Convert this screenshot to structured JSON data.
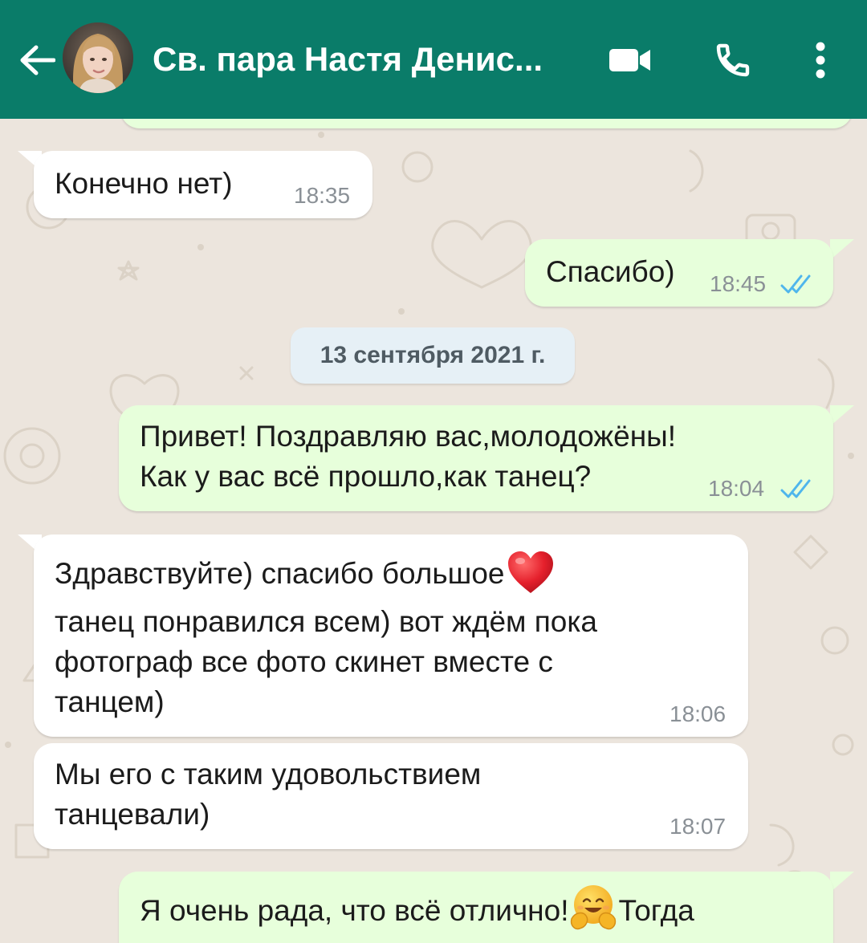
{
  "header": {
    "title": "Св. пара Настя Денис..."
  },
  "date_separator": "13 сентября 2021 г.",
  "messages": [
    {
      "direction": "in",
      "text": "Конечно нет)",
      "time": "18:35"
    },
    {
      "direction": "out",
      "text": "Спасибо)",
      "time": "18:45",
      "status": "read"
    },
    {
      "direction": "out",
      "line1": "Привет! Поздравляю вас,молодожёны!",
      "line2": "Как у вас всё прошло,как танец?",
      "time": "18:04",
      "status": "read"
    },
    {
      "direction": "in",
      "line1": "Здравствуйте) спасибо большое",
      "line2": "танец понравился всем) вот ждём пока",
      "line3": "фотограф все фото скинет вместе с",
      "line4": "танцем)",
      "time": "18:06",
      "emoji": "red-heart"
    },
    {
      "direction": "in",
      "line1": "Мы его с таким удовольствием",
      "line2": "танцевали)",
      "time": "18:07"
    },
    {
      "direction": "out",
      "text_before": "Я очень рада, что всё отлично!",
      "text_after": "Тогда",
      "emoji": "hugging-face"
    }
  ],
  "colors": {
    "header": "#0a7c69",
    "chat_background": "#ece5dd",
    "incoming_bubble": "#ffffff",
    "outgoing_bubble": "#e7ffdb",
    "read_ticks": "#4fb6ec"
  }
}
